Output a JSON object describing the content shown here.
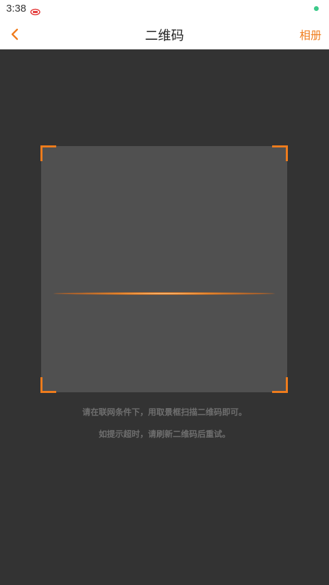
{
  "status_bar": {
    "time": "3:38",
    "app_icon": "app-notification-icon",
    "indicator_color": "#3cc98a"
  },
  "nav": {
    "back_icon": "chevron-left-icon",
    "title": "二维码",
    "album_label": "相册"
  },
  "scanner": {
    "hint_line_1": "请在联网条件下，用取景框扫描二维码即可。",
    "hint_line_2": "如提示超时，请刷新二维码后重试。"
  },
  "colors": {
    "accent": "#f07c1c",
    "background": "#333333",
    "frame": "#505050",
    "hint_text": "#6e6e6e"
  }
}
